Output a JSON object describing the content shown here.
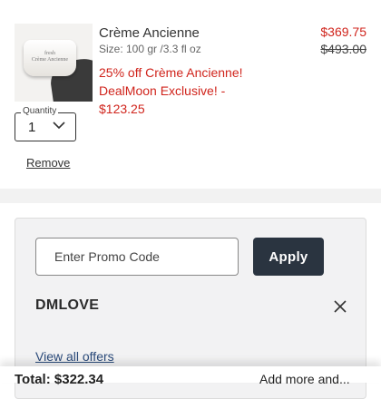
{
  "product": {
    "name": "Crème Ancienne",
    "size": "Size: 100 gr /3.3 fl oz",
    "price": "$369.75",
    "original_price": "$493.00",
    "deal_text": "25% off Crème Ancienne! DealMoon Exclusive! - $123.25",
    "image_label": "fresh\nCrème Ancienne",
    "quantity_label": "Quantity",
    "quantity_value": "1",
    "remove_label": "Remove"
  },
  "promo": {
    "input_placeholder": "Enter Promo Code",
    "apply_label": "Apply",
    "applied_code": "DMLOVE",
    "view_offers_label": "View all offers"
  },
  "footer": {
    "total_label": "Total: $322.34",
    "link_label": "Add more and..."
  },
  "colors": {
    "sale_red": "#d0241c",
    "apply_bg": "#2a3440",
    "card_bg": "#f2f2f3",
    "link_blue": "#2a4a7a"
  },
  "icons": {
    "quantity_dropdown": "chevron-down-icon",
    "remove_code": "close-icon"
  }
}
